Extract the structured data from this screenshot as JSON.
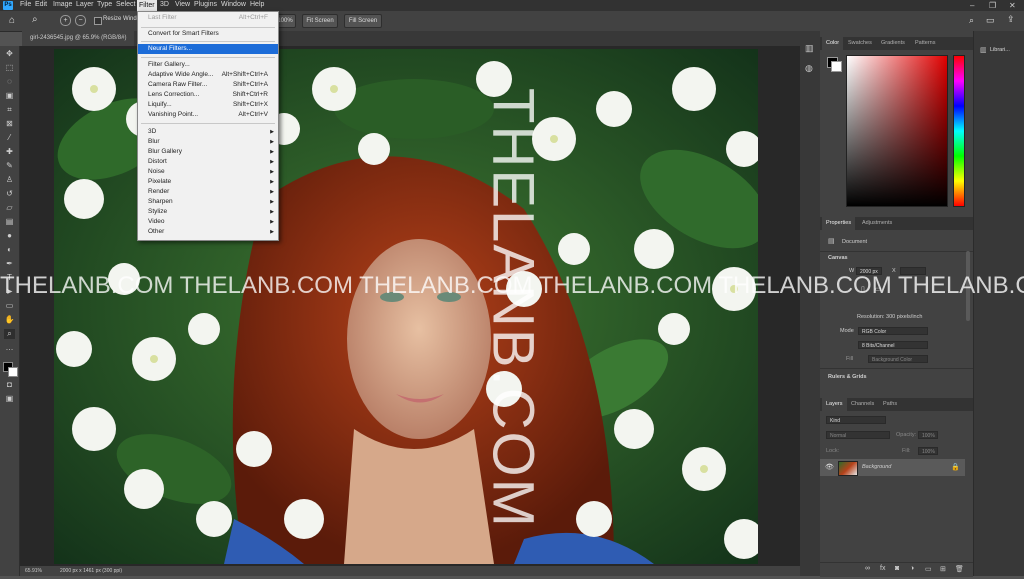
{
  "app": {
    "logo": "Ps",
    "menu": [
      "File",
      "Edit",
      "Image",
      "Layer",
      "Type",
      "Select",
      "Filter",
      "3D",
      "View",
      "Plugins",
      "Window",
      "Help"
    ],
    "active_menu": "Filter"
  },
  "options_bar": {
    "resize_windows": "Resize Windows",
    "zoom_value": "100%",
    "fit_screen": "Fit Screen",
    "fill_screen": "Fill Screen"
  },
  "document": {
    "tab_title": "girl-2436545.jpg @ 65.9% (RGB/8#)",
    "zoom_status": "65.91%",
    "size_status": "2000 px x 1461 px (300 ppi)"
  },
  "filter_menu": {
    "items": [
      {
        "label": "Last Filter",
        "shortcut": "Alt+Ctrl+F",
        "disabled": true
      },
      {
        "separator": true
      },
      {
        "label": "Convert for Smart Filters",
        "shortcut": ""
      },
      {
        "separator": true
      },
      {
        "label": "Neural Filters...",
        "shortcut": "",
        "highlighted": true
      },
      {
        "separator": true
      },
      {
        "label": "Filter Gallery...",
        "shortcut": ""
      },
      {
        "label": "Adaptive Wide Angle...",
        "shortcut": "Alt+Shift+Ctrl+A"
      },
      {
        "label": "Camera Raw Filter...",
        "shortcut": "Shift+Ctrl+A"
      },
      {
        "label": "Lens Correction...",
        "shortcut": "Shift+Ctrl+R"
      },
      {
        "label": "Liquify...",
        "shortcut": "Shift+Ctrl+X"
      },
      {
        "label": "Vanishing Point...",
        "shortcut": "Alt+Ctrl+V"
      },
      {
        "separator": true
      },
      {
        "label": "3D",
        "submenu": true
      },
      {
        "label": "Blur",
        "submenu": true
      },
      {
        "label": "Blur Gallery",
        "submenu": true
      },
      {
        "label": "Distort",
        "submenu": true
      },
      {
        "label": "Noise",
        "submenu": true
      },
      {
        "label": "Pixelate",
        "submenu": true
      },
      {
        "label": "Render",
        "submenu": true
      },
      {
        "label": "Sharpen",
        "submenu": true
      },
      {
        "label": "Stylize",
        "submenu": true
      },
      {
        "label": "Video",
        "submenu": true
      },
      {
        "label": "Other",
        "submenu": true
      }
    ]
  },
  "color_panel": {
    "tabs": [
      "Color",
      "Swatches",
      "Gradients",
      "Patterns"
    ]
  },
  "properties_panel": {
    "tabs": [
      "Properties",
      "Adjustments"
    ],
    "document_label": "Document",
    "canvas_header": "Canvas",
    "w_label": "W",
    "w_value": "2000 px",
    "x_label": "X",
    "h_label": "H",
    "resolution": "Resolution: 300 pixels/inch",
    "mode_label": "Mode",
    "mode_value": "RGB Color",
    "depth_value": "8 Bits/Channel",
    "fill_label": "Fill",
    "fill_value": "Background Color",
    "rulers_header": "Rulers & Grids"
  },
  "layers_panel": {
    "tabs": [
      "Layers",
      "Channels",
      "Paths"
    ],
    "kind_placeholder": "Kind",
    "blend_mode": "Normal",
    "opacity_label": "Opacity:",
    "opacity_value": "100%",
    "lock_label": "Lock:",
    "fill_label": "Fill:",
    "fill_value": "100%",
    "layer_name": "Background"
  },
  "libraries": {
    "label": "Librari..."
  },
  "watermark": {
    "horizontal": "THELANB.COM THELANB.COM THELANB.COM THELANB.COM THELANB.COM THELANB.COM TH",
    "vertical": "THELANB.COM"
  },
  "colors": {
    "highlight": "#1c6cd8",
    "ps_blue": "#31a8ff",
    "panel_bg": "#424242"
  }
}
